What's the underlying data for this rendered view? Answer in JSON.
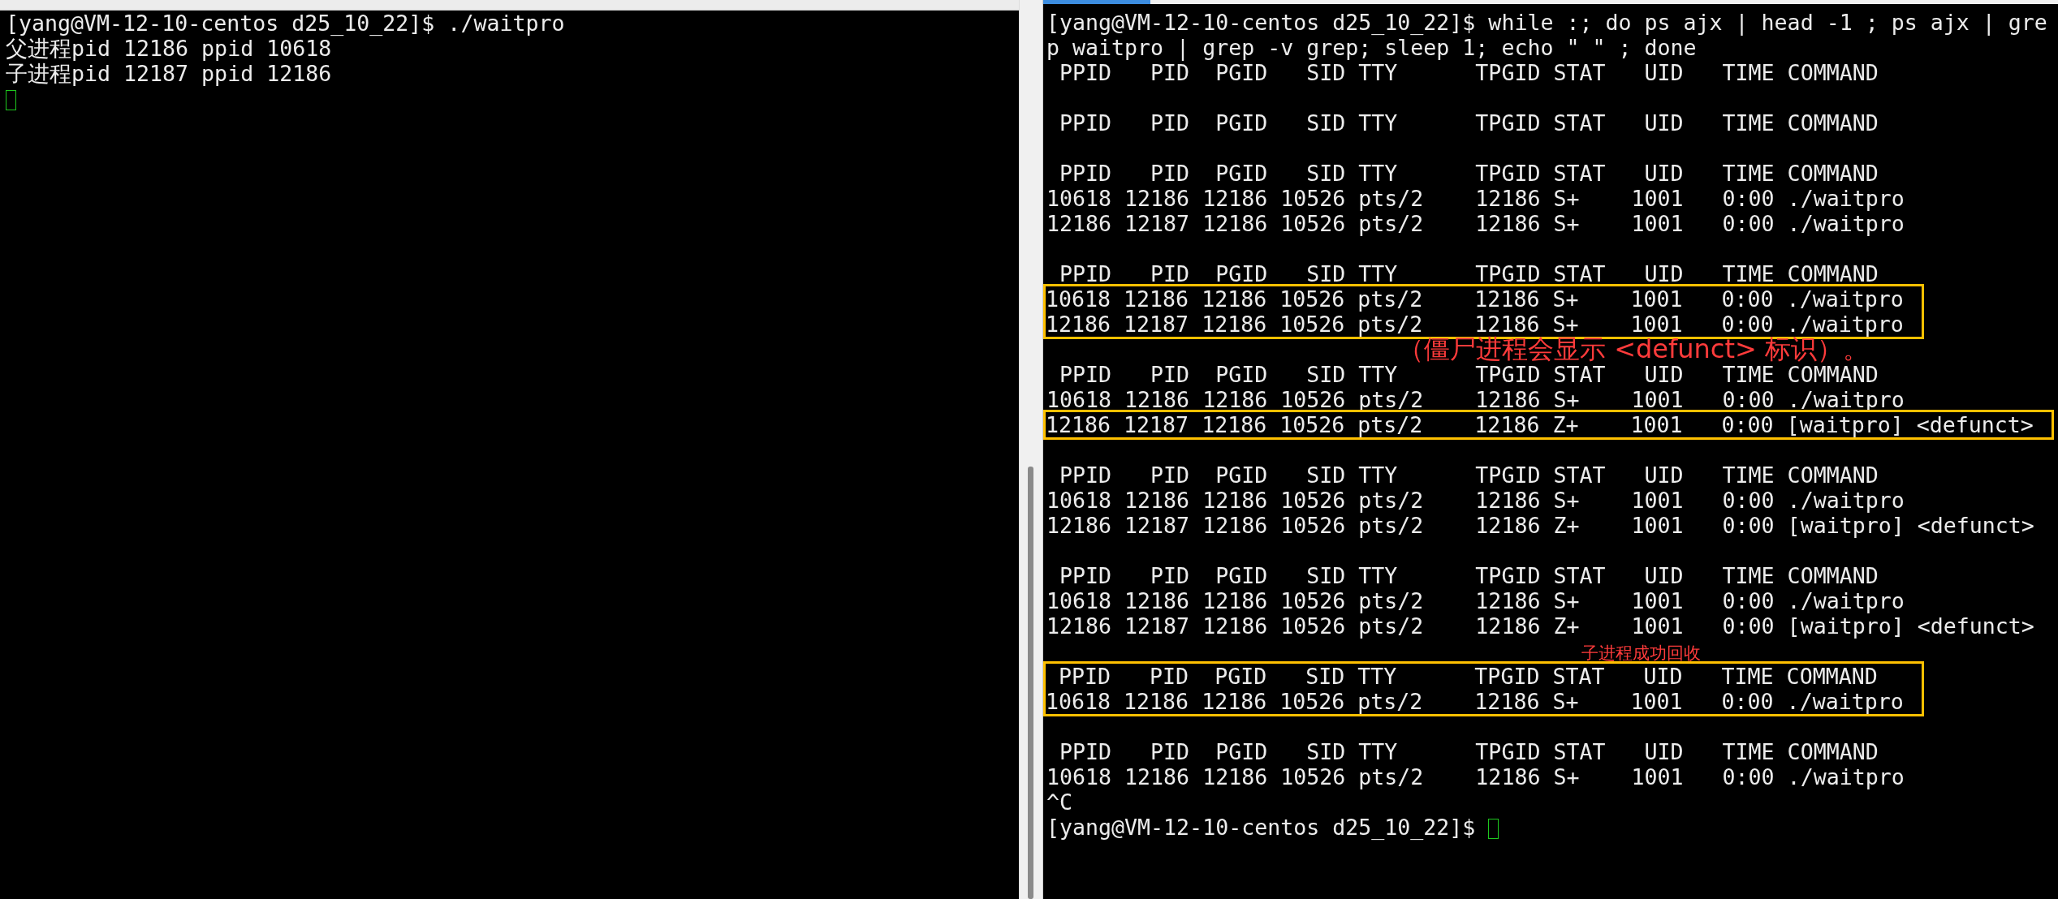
{
  "left_terminal": {
    "lines": [
      {
        "text": "[yang@VM-12-10-centos d25_10_22]$ ./waitpro"
      },
      {
        "text": "父进程pid 12186 ppid 10618"
      },
      {
        "text": "子进程pid 12187 ppid 12186"
      }
    ],
    "cursor": true
  },
  "right_terminal": {
    "rows": [
      {
        "kind": "text",
        "text": "[yang@VM-12-10-centos d25_10_22]$ while :; do ps ajx | head -1 ; ps ajx | gre"
      },
      {
        "kind": "text",
        "text": "p waitpro | grep -v grep; sleep 1; echo \" \" ; done"
      },
      {
        "kind": "text",
        "text": " PPID   PID  PGID   SID TTY      TPGID STAT   UID   TIME COMMAND"
      },
      {
        "kind": "blank"
      },
      {
        "kind": "text",
        "text": " PPID   PID  PGID   SID TTY      TPGID STAT   UID   TIME COMMAND"
      },
      {
        "kind": "blank"
      },
      {
        "kind": "text",
        "text": " PPID   PID  PGID   SID TTY      TPGID STAT   UID   TIME COMMAND"
      },
      {
        "kind": "text",
        "text": "10618 12186 12186 10526 pts/2    12186 S+    1001   0:00 ./waitpro"
      },
      {
        "kind": "text",
        "text": "12186 12187 12186 10526 pts/2    12186 S+    1001   0:00 ./waitpro"
      },
      {
        "kind": "blank"
      },
      {
        "kind": "text",
        "text": " PPID   PID  PGID   SID TTY      TPGID STAT   UID   TIME COMMAND"
      },
      {
        "kind": "box",
        "lines": [
          "10618 12186 12186 10526 pts/2    12186 S+    1001   0:00 ./waitpro",
          "12186 12187 12186 10526 pts/2    12186 S+    1001   0:00 ./waitpro"
        ]
      },
      {
        "kind": "note",
        "text": "（僵尸进程会显示 <defunct> 标识）。"
      },
      {
        "kind": "text",
        "text": " PPID   PID  PGID   SID TTY      TPGID STAT   UID   TIME COMMAND"
      },
      {
        "kind": "text",
        "text": "10618 12186 12186 10526 pts/2    12186 S+    1001   0:00 ./waitpro"
      },
      {
        "kind": "box",
        "lines": [
          "12186 12187 12186 10526 pts/2    12186 Z+    1001   0:00 [waitpro] <defunct>"
        ]
      },
      {
        "kind": "blank"
      },
      {
        "kind": "text",
        "text": " PPID   PID  PGID   SID TTY      TPGID STAT   UID   TIME COMMAND"
      },
      {
        "kind": "text",
        "text": "10618 12186 12186 10526 pts/2    12186 S+    1001   0:00 ./waitpro"
      },
      {
        "kind": "text",
        "text": "12186 12187 12186 10526 pts/2    12186 Z+    1001   0:00 [waitpro] <defunct>"
      },
      {
        "kind": "blank"
      },
      {
        "kind": "text",
        "text": " PPID   PID  PGID   SID TTY      TPGID STAT   UID   TIME COMMAND"
      },
      {
        "kind": "text",
        "text": "10618 12186 12186 10526 pts/2    12186 S+    1001   0:00 ./waitpro"
      },
      {
        "kind": "text",
        "text": "12186 12187 12186 10526 pts/2    12186 Z+    1001   0:00 [waitpro] <defunct>"
      },
      {
        "kind": "caption",
        "text": "子进程成功回收"
      },
      {
        "kind": "box",
        "lines": [
          " PPID   PID  PGID   SID TTY      TPGID STAT   UID   TIME COMMAND",
          "10618 12186 12186 10526 pts/2    12186 S+    1001   0:00 ./waitpro"
        ]
      },
      {
        "kind": "blank"
      },
      {
        "kind": "text",
        "text": " PPID   PID  PGID   SID TTY      TPGID STAT   UID   TIME COMMAND"
      },
      {
        "kind": "text",
        "text": "10618 12186 12186 10526 pts/2    12186 S+    1001   0:00 ./waitpro"
      },
      {
        "kind": "text",
        "text": "^C"
      },
      {
        "kind": "prompt",
        "text": "[yang@VM-12-10-centos d25_10_22]$ "
      }
    ]
  }
}
